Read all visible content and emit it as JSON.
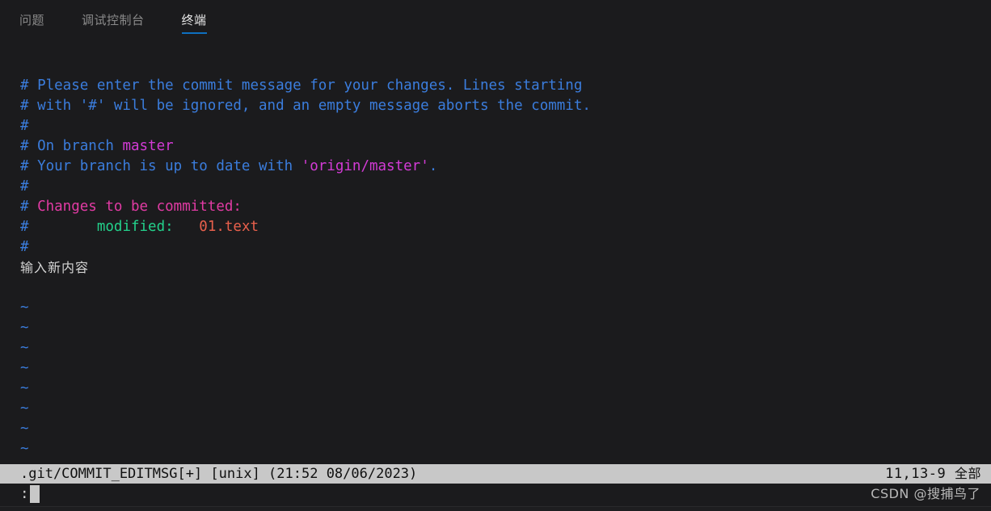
{
  "panel": {
    "tabs": [
      {
        "label": "问题",
        "active": false
      },
      {
        "label": "调试控制台",
        "active": false
      },
      {
        "label": "终端",
        "active": true
      }
    ],
    "active_underline_color": "#0e70c0",
    "background_color": "#1b1b1d"
  },
  "terminal": {
    "lines": [
      {
        "id": "l1",
        "text": "# Please enter the commit message for your changes. Lines starting"
      },
      {
        "id": "l2",
        "text": "# with '#' will be ignored, and an empty message aborts the commit."
      },
      {
        "id": "l3",
        "text": "#"
      },
      {
        "id": "l4",
        "prefix": "# On branch ",
        "highlight": "master"
      },
      {
        "id": "l5",
        "prefix": "# Your branch is up to date with ",
        "highlight": "'origin/master'",
        "suffix": "."
      },
      {
        "id": "l6",
        "text": "#"
      },
      {
        "id": "l7",
        "prefix": "# ",
        "highlight": "Changes to be committed:"
      },
      {
        "id": "l8",
        "prefix": "#",
        "indent": "        ",
        "label": "modified:",
        "colon": "",
        "file": "01.text"
      },
      {
        "id": "l9",
        "text": "#"
      },
      {
        "id": "l10",
        "text": "输入新内容"
      },
      {
        "id": "l11",
        "text": ""
      },
      {
        "id": "l12",
        "text": "~"
      },
      {
        "id": "l13",
        "text": "~"
      },
      {
        "id": "l14",
        "text": "~"
      },
      {
        "id": "l15",
        "text": "~"
      },
      {
        "id": "l16",
        "text": "~"
      },
      {
        "id": "l17",
        "text": "~"
      },
      {
        "id": "l18",
        "text": "~"
      },
      {
        "id": "l19",
        "text": "~"
      }
    ],
    "colors": {
      "comment_blue": "#3b7ddd",
      "branch_magenta": "#d33bd6",
      "section_pink": "#e23ba4",
      "modified_green": "#23d18b",
      "file_orange": "#e8604c",
      "user_text_white": "#d4d4d4"
    }
  },
  "vim": {
    "status_file": ".git/COMMIT_EDITMSG[+] [unix] (21:52 08/06/2023)",
    "status_position": "11,13-9",
    "status_scroll": "全部",
    "status_bg_color": "#c8c8c8",
    "status_fg_color": "#101010",
    "command_prompt": ":"
  },
  "watermark": {
    "text": "CSDN @搜捕鸟了"
  }
}
